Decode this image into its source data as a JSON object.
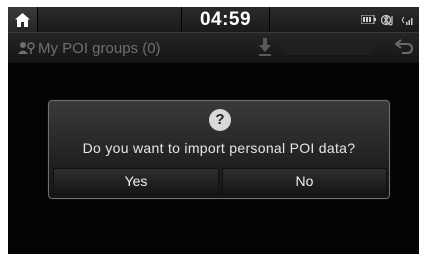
{
  "status_bar": {
    "time": "04:59",
    "icons": [
      "home-icon",
      "battery-icon",
      "bluetooth-audio-icon",
      "signal-icon"
    ]
  },
  "title_bar": {
    "title": "My POI groups (0)",
    "icons": [
      "poi-groups-icon",
      "download-icon",
      "back-icon"
    ]
  },
  "dialog": {
    "icon": "question-icon",
    "icon_glyph": "?",
    "message": "Do you want to import personal POI data?",
    "yes_label": "Yes",
    "no_label": "No"
  },
  "colors": {
    "background": "#040404",
    "dialog_border": "#707070",
    "text": "#e6e6e6",
    "disabled_text": "#6e6e6e"
  }
}
